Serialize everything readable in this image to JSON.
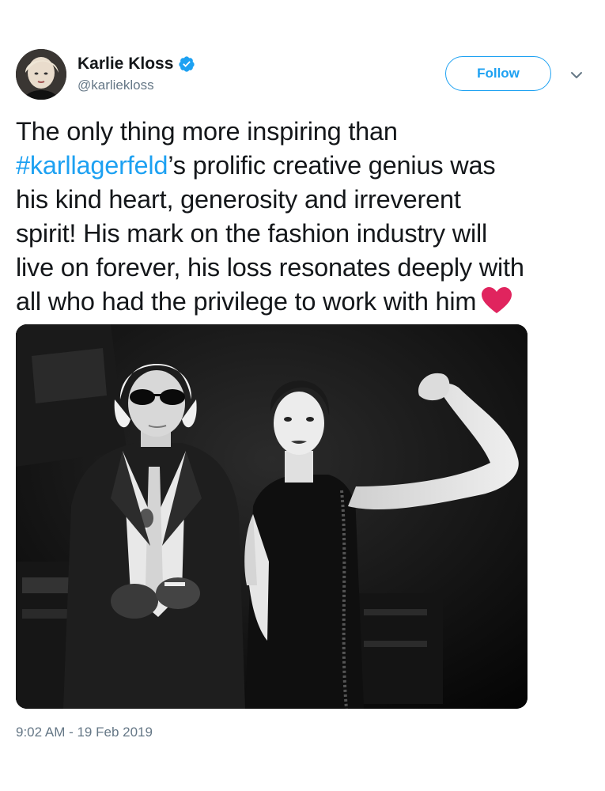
{
  "user": {
    "display_name": "Karlie Kloss",
    "handle": "@karliekloss",
    "verified": true,
    "avatar_icon": "profile-photo"
  },
  "actions": {
    "follow_label": "Follow",
    "more_icon": "chevron-down-icon"
  },
  "tweet": {
    "lines": [
      "The only thing more inspiring than",
      "’s prolific creative genius was",
      "his kind heart, generosity and irreverent",
      "spirit! His mark on the fashion industry will",
      "live on forever, his loss resonates deeply with",
      "all who had the privilege to work with him"
    ],
    "hashtag": "#karllagerfeld",
    "emoji": "heart-emoji",
    "timestamp": "9:02 AM - 19 Feb 2019"
  },
  "media": {
    "type": "photo",
    "style": "black-and-white"
  },
  "colors": {
    "accent": "#1da1f2",
    "text": "#14171a",
    "secondary": "#657786",
    "heart": "#e0245e"
  }
}
